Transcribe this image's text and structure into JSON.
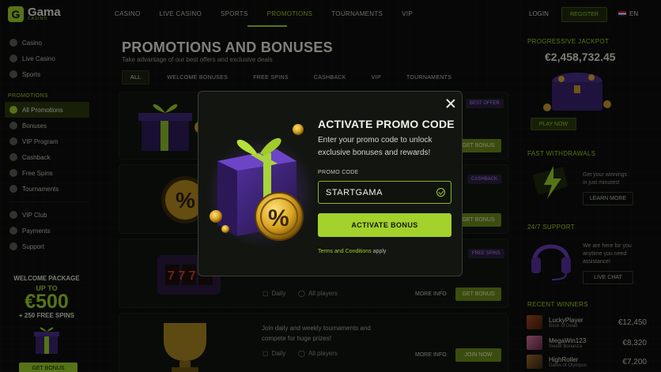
{
  "brand": {
    "name": "Gama",
    "sub": "CASINO"
  },
  "nav": {
    "items": [
      "CASINO",
      "LIVE CASINO",
      "SPORTS",
      "PROMOTIONS",
      "TOURNAMENTS",
      "VIP"
    ],
    "active": "PROMOTIONS",
    "login": "LOGIN",
    "register": "REGISTER",
    "lang": "EN"
  },
  "sidebar": {
    "main": [
      "Casino",
      "Live Casino",
      "Sports"
    ],
    "section_title": "PROMOTIONS",
    "promos": [
      "All Promotions",
      "Bonuses",
      "VIP Program",
      "Cashback",
      "Free Spins",
      "Tournaments"
    ],
    "bottom": [
      "VIP Club",
      "Payments",
      "Support"
    ],
    "welcome": {
      "title": "WELCOME PACKAGE",
      "up_to": "UP TO",
      "amount": "€500",
      "spins": "+ 250 FREE SPINS",
      "button": "GET BONUS"
    }
  },
  "page": {
    "title": "PROMOTIONS AND BONUSES",
    "subtitle": "Take advantage of our best offers and exclusive deals",
    "tabs": [
      "ALL",
      "WELCOME BONUSES",
      "FREE SPINS",
      "CASHBACK",
      "VIP",
      "TOURNAMENTS"
    ],
    "active_tab": "ALL"
  },
  "cards": [
    {
      "badge": "BEST OFFER",
      "button": "GET BONUS"
    },
    {
      "badge": "CASHBACK",
      "button": "GET BONUS"
    },
    {
      "badge": "FREE SPINS",
      "freq": "Daily",
      "audience": "All players",
      "more": "MORE INFO",
      "button": "GET BONUS"
    },
    {
      "text": "Join daily and weekly tournaments and compete for huge prizes!",
      "freq": "Daily",
      "audience": "All players",
      "more": "MORE INFO",
      "button": "JOIN NOW"
    }
  ],
  "right": {
    "jackpot": {
      "title": "PROGRESSIVE JACKPOT",
      "amount": "€2,458,732.45",
      "button": "PLAY NOW"
    },
    "withdrawals": {
      "title": "FAST WITHDRAWALS",
      "text": "Get your winnings in just minutes!",
      "button": "LEARN MORE"
    },
    "support": {
      "title": "24/7 SUPPORT",
      "text": "We are here for you anytime you need assistance!",
      "button": "LIVE CHAT"
    },
    "winners": {
      "title": "RECENT WINNERS",
      "rows": [
        {
          "name": "LuckyPlayer",
          "game": "Book of Dead",
          "amount": "€12,450"
        },
        {
          "name": "MegaWin123",
          "game": "Sweet Bonanza",
          "amount": "€8,320"
        },
        {
          "name": "HighRoller",
          "game": "Gates of Olympus",
          "amount": "€7,200"
        }
      ]
    }
  },
  "modal": {
    "title": "ACTIVATE PROMO CODE",
    "description": "Enter your promo code to unlock exclusive bonuses and rewards!",
    "label": "PROMO CODE",
    "code": "STARTGAMA",
    "button": "ACTIVATE BONUS",
    "terms_link": "Terms and Conditions",
    "terms_suffix": "apply"
  },
  "colors": {
    "accent": "#9fd12b",
    "bg": "#0c0e0b",
    "purple": "#6b3fb8"
  }
}
